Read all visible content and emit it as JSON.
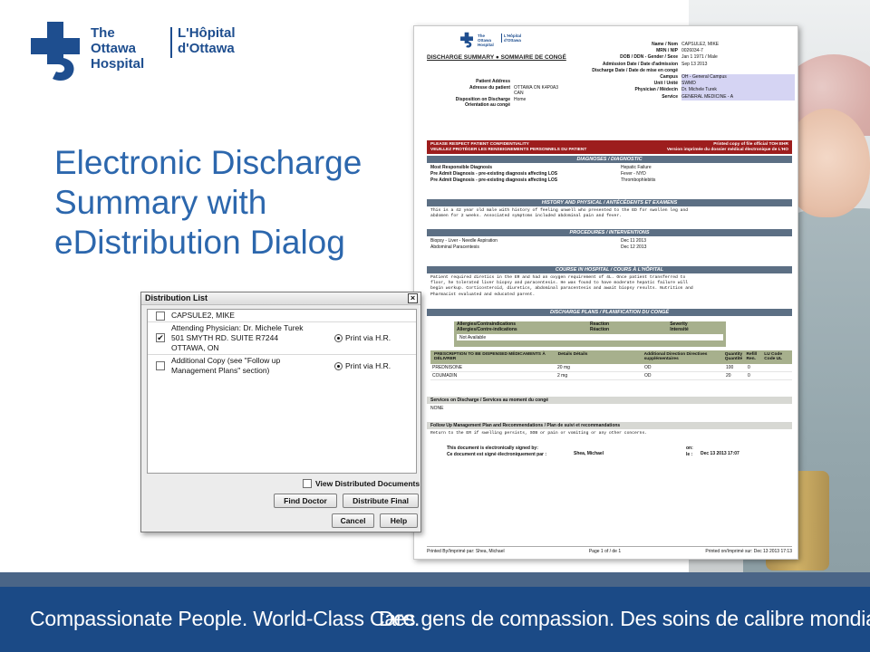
{
  "logo": {
    "name_en_line1": "The Ottawa",
    "name_en_line2": "Hospital",
    "name_fr_line1": "L'Hôpital",
    "name_fr_line2": "d'Ottawa",
    "icon": "ottawa-hospital-cross-logo",
    "brand_color": "#1e4e8f"
  },
  "slide_title": {
    "line1": "Electronic Discharge",
    "line2": "Summary with",
    "line3": "eDistribution Dialog",
    "color": "#2c67ad"
  },
  "document": {
    "logo_en": "The Ottawa Hospital",
    "logo_fr": "L'Hôpital d'Ottawa",
    "title": "DISCHARGE SUMMARY ● SOMMAIRE DE CONGÉ",
    "patient": [
      {
        "label": "Name / Nom",
        "value": "CAPSULE2, MIKE"
      },
      {
        "label": "MRN / NIP",
        "value": "0026034-7"
      },
      {
        "label": "DOB / DDN - Gender / Sexe",
        "value": "Jan 1 1971      / Male"
      },
      {
        "label": "Admission Date / Date d'admission",
        "value": "Sep 13 2013"
      },
      {
        "label": "Discharge Date / Date de mise en congé",
        "value": ""
      },
      {
        "label": "Campus",
        "value": "OH - General Campus"
      },
      {
        "label": "Unit / Unité",
        "value": "SWMD"
      },
      {
        "label": "Physician / Médecin",
        "value": "Dr. Michele Turek"
      },
      {
        "label": "Service",
        "value": "GENERAL MEDICINE - A"
      }
    ],
    "address": [
      {
        "label": "Patient Address",
        "value": ""
      },
      {
        "label": "Adresse du patient",
        "value": "OTTAWA ON K4P0A3"
      },
      {
        "label": "",
        "value": "CAN"
      },
      {
        "label": "Disposition on Discharge",
        "value": "Home"
      },
      {
        "label": "Orientation au congé",
        "value": ""
      }
    ],
    "confidential_left_1": "PLEASE RESPECT PATIENT CONFIDENTIALITY",
    "confidential_left_2": "VEUILLEZ PROTÉGER LES RENSEIGNEMENTS PERSONNELS DU PATIENT",
    "confidential_right_1": "Printed copy of file official TOH EHR",
    "confidential_right_2": "Version imprimée du dossier médical électronique de L'HO",
    "diagnoses_head": "DIAGNOSES / DIAGNOSTIC",
    "diagnoses": [
      {
        "label": "Most Responsible Diagnosis",
        "value": "Hepatic Failure"
      },
      {
        "label": "Pre Admit Diagnosis - pre-existing diagnosis affecting LOS",
        "value": "Fever - NYD"
      },
      {
        "label": "Pre Admit Diagnosis - pre-existing diagnosis affecting LOS",
        "value": "Thrombophlebitis"
      }
    ],
    "history_head": "HISTORY AND PHYSICAL / ANTÉCÉDENTS ET EXAMENS",
    "history_text_1": "This is a 42 year old male with history of feeling unwell who presented to the ED for swollen leg and",
    "history_text_2": "abdomen for 2 weeks.  Associated symptoms included abdominal pain and fever.",
    "procedures_head": "PROCEDURES / INTERVENTIONS",
    "procedures": [
      {
        "label": "Biopsy - Liver - Needle Aspiration",
        "value": "Dec 11 2013"
      },
      {
        "label": "Abdominal Paracentesis",
        "value": "Dec 12 2013"
      }
    ],
    "course_head": "COURSE IN HOSPITAL / COURS À L'HÔPITAL",
    "course_text_1": " Patient required diretics in the ER and had an oxygen requirement of 4L.  Once patient transferred to",
    "course_text_2": "floor, he tolerated liver biopsy and paracentesis.  He was found to have moderate hepatic failure will",
    "course_text_3": "begin workup.  Corticosteroid, diuretics, abdominal paracentesis and await biopsy results. Nutrition and",
    "course_text_4": "Pharmacist evaluated and educated parent.",
    "plans_head": "DISCHARGE PLANS / PLANIFICATION DU CONGÉ",
    "allergy_col1": "Allergies/Contraindications",
    "allergy_col1_fr": "Allergies/Contre-indications",
    "allergy_col2": "Reaction",
    "allergy_col2_fr": "Réaction",
    "allergy_col3": "Severity",
    "allergy_col3_fr": "Intensité",
    "allergy_value": "Not Available",
    "rx_headers": [
      "PRESCRIPTION TO BE DISPENSED MÉDICAMENTS À DÉLIVRER",
      "Details Détails",
      "Additional Direction Directives supplémentaires",
      "Quantity Quantité",
      "Refill Ren.",
      "LU Code Code UL"
    ],
    "rx_rows": [
      {
        "drug": "PREDNISONE",
        "details": "20 mg",
        "direction": "OD",
        "qty": "100",
        "refill": "0"
      },
      {
        "drug": "COUMADIN",
        "details": "2 mg",
        "direction": "OD",
        "qty": "20",
        "refill": "0"
      }
    ],
    "services_head": "Services on Discharge / Services au moment du congé",
    "services_value": "NONE",
    "followup_head": "Follow Up Management Plan and Recommendations / Plan de suivi et recommandations",
    "followup_text": "Return to the ER if swelling persists, SOB or pain or vomiting or any other concerns.",
    "signed_en": "This document is electronically signed by:",
    "signed_fr": "Ce document est signé électroniquement par :",
    "signer": "Shea, Michael",
    "on_label": "on:",
    "le_label": "le :",
    "signed_date": "Dec 13 2013 17:07",
    "footer_printed_by": "Printed By/Imprimé par: Shea, Michael",
    "footer_page": "Page 1 of / de 1",
    "footer_printed_on": "Printed on/Imprimé sur: Dec 13 2013 17:13",
    "header_red": "#9d1d1d",
    "section_blue_grey": "#5c6f84",
    "table_olive": "#a7b08d"
  },
  "dialog": {
    "title": "Distribution List",
    "close_icon": "close-x",
    "items": [
      {
        "lines": [
          "CAPSULE2, MIKE"
        ],
        "checked": false
      },
      {
        "lines": [
          "Attending Physician: Dr. Michele Turek",
          "501 SMYTH RD. SUITE R7244",
          "OTTAWA, ON"
        ],
        "checked": true,
        "option": "Print via H.R."
      },
      {
        "lines": [
          "Additional Copy (see \"Follow up",
          "Management Plans\" section)"
        ],
        "checked": false,
        "option": "Print via H.R."
      }
    ],
    "view_distributed": "View Distributed Documents",
    "find_doctor": "Find Doctor",
    "distribute_final": "Distribute Final",
    "cancel": "Cancel",
    "help": "Help"
  },
  "footer": {
    "tagline_en": "Compassionate People. World-Class Care.",
    "tagline_fr": "Des gens de compassion. Des soins de calibre mondial.",
    "color": "#1b4a86"
  }
}
